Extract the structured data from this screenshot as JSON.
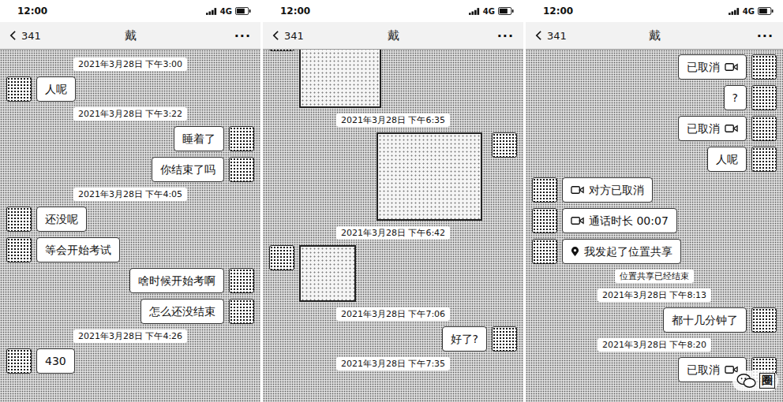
{
  "panels": [
    {
      "status_bar": {
        "time": "12:00",
        "network": "4G"
      },
      "header": {
        "count": "341",
        "title": "戴",
        "menu": "···"
      },
      "messages": [
        {
          "kind": "time",
          "text": "2021年3月28日 下午3:00"
        },
        {
          "kind": "text",
          "from": "other",
          "text": "人呢"
        },
        {
          "kind": "time",
          "text": "2021年3月28日 下午3:22"
        },
        {
          "kind": "text",
          "from": "me",
          "text": "睡着了"
        },
        {
          "kind": "text",
          "from": "me",
          "text": "你结束了吗"
        },
        {
          "kind": "time",
          "text": "2021年3月28日 下午4:05"
        },
        {
          "kind": "text",
          "from": "other",
          "text": "还没呢"
        },
        {
          "kind": "text",
          "from": "other",
          "text": "等会开始考试"
        },
        {
          "kind": "text",
          "from": "me",
          "text": "啥时候开始考啊"
        },
        {
          "kind": "text",
          "from": "me",
          "text": "怎么还没结束"
        },
        {
          "kind": "time",
          "text": "2021年3月28日 下午4:26"
        },
        {
          "kind": "text",
          "from": "other",
          "text": "430"
        }
      ]
    },
    {
      "status_bar": {
        "time": "12:00",
        "network": "4G"
      },
      "header": {
        "count": "341",
        "title": "戴",
        "menu": "···"
      },
      "messages": [
        {
          "kind": "image",
          "from": "other"
        },
        {
          "kind": "time",
          "text": "2021年3月28日 下午6:35"
        },
        {
          "kind": "image",
          "from": "me"
        },
        {
          "kind": "time",
          "text": "2021年3月28日 下午6:42"
        },
        {
          "kind": "image",
          "from": "other"
        },
        {
          "kind": "time",
          "text": "2021年3月28日 下午7:06"
        },
        {
          "kind": "text",
          "from": "me",
          "text": "好了?"
        },
        {
          "kind": "time",
          "text": "2021年3月28日 下午7:35"
        }
      ]
    },
    {
      "status_bar": {
        "time": "12:00",
        "network": "4G"
      },
      "header": {
        "count": "341",
        "title": "戴",
        "menu": "···"
      },
      "messages": [
        {
          "kind": "call",
          "from": "me",
          "text": "已取消"
        },
        {
          "kind": "text",
          "from": "me",
          "text": "?"
        },
        {
          "kind": "call",
          "from": "me",
          "text": "已取消"
        },
        {
          "kind": "text",
          "from": "me",
          "text": "人呢"
        },
        {
          "kind": "call",
          "from": "other",
          "text": "对方已取消"
        },
        {
          "kind": "call",
          "from": "other",
          "text": "通话时长 00:07"
        },
        {
          "kind": "location",
          "from": "other",
          "text": "我发起了位置共享"
        },
        {
          "kind": "system",
          "text": "位置共享已经结束"
        },
        {
          "kind": "time",
          "text": "2021年3月28日 下午8:13"
        },
        {
          "kind": "text",
          "from": "me",
          "text": "都十几分钟了"
        },
        {
          "kind": "time",
          "text": "2021年3月28日 下午8:20"
        },
        {
          "kind": "call",
          "from": "me",
          "text": "已取消"
        }
      ]
    }
  ],
  "watermark": {
    "text": "圈"
  }
}
